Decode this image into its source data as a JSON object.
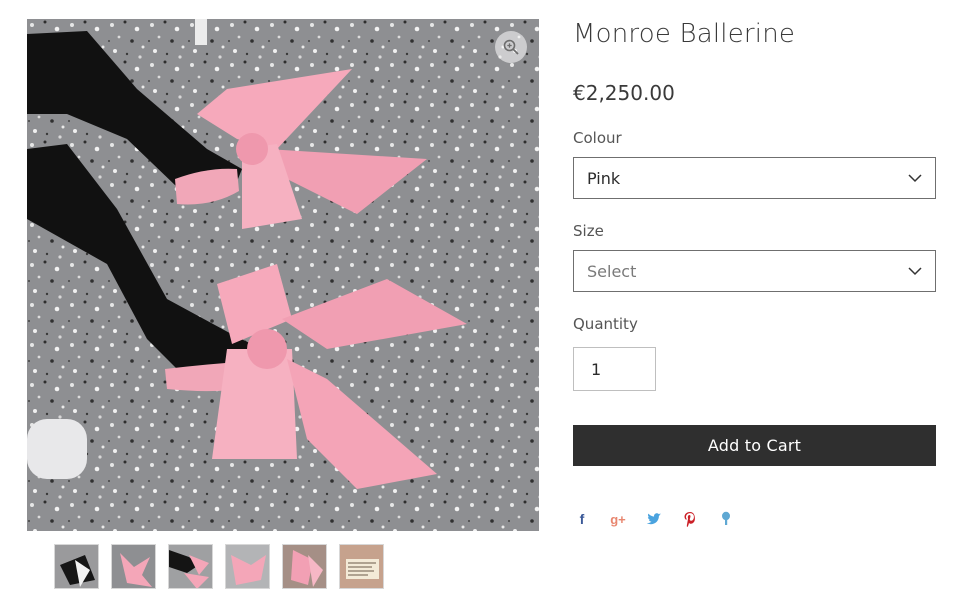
{
  "product": {
    "title": "Monroe Ballerine",
    "price": "€2,250.00"
  },
  "options": {
    "colour": {
      "label": "Colour",
      "value": "Pink"
    },
    "size": {
      "label": "Size",
      "placeholder": "Select"
    },
    "quantity": {
      "label": "Quantity",
      "value": "1"
    }
  },
  "actions": {
    "add_to_cart": "Add to Cart"
  },
  "icons": {
    "zoom": "magnifier-icon",
    "dropdown": "chevron-down-icon",
    "social": [
      "facebook-icon",
      "google-plus-icon",
      "twitter-icon",
      "pinterest-icon",
      "tumblr-icon"
    ]
  },
  "colors": {
    "button": "#2f2f2f",
    "facebook": "#3b5998",
    "google_plus": "#e8866f",
    "twitter": "#4aa3df",
    "pinterest": "#cb2027",
    "tumblr": "#5fa8d3",
    "bow_pink": "#f4a6b8"
  },
  "thumbnails_count": 6
}
